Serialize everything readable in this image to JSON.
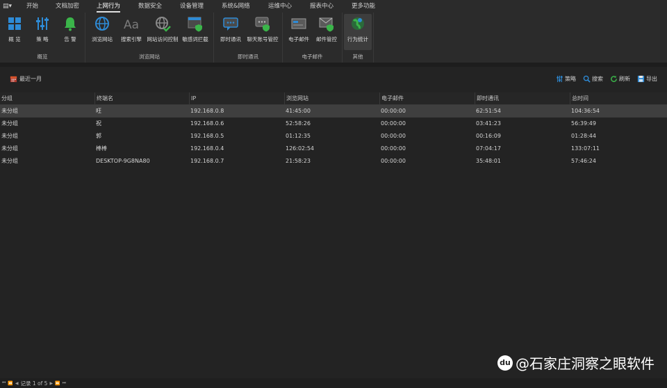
{
  "menu": {
    "app_icon": "▤▾",
    "items": [
      "开始",
      "文档加密",
      "上网行为",
      "数据安全",
      "设备管理",
      "系统&网络",
      "运维中心",
      "报表中心",
      "更多功能"
    ],
    "active": "上网行为"
  },
  "ribbon": {
    "groups": [
      {
        "label": "概览",
        "buttons": [
          {
            "label": "概 览",
            "icon": "dashboard-icon"
          },
          {
            "label": "策 略",
            "icon": "policy-sliders-icon"
          },
          {
            "label": "告 警",
            "icon": "bell-icon"
          }
        ]
      },
      {
        "label": "浏览网站",
        "buttons": [
          {
            "label": "浏览网站",
            "icon": "globe-icon"
          },
          {
            "label": "搜索引擎",
            "icon": "font-aa-icon"
          },
          {
            "label": "网站访问控制",
            "icon": "globe-check-icon"
          },
          {
            "label": "敏感词拦截",
            "icon": "window-shield-icon"
          }
        ]
      },
      {
        "label": "即时通讯",
        "buttons": [
          {
            "label": "即时通讯",
            "icon": "chat-icon"
          },
          {
            "label": "聊天账号管控",
            "icon": "chat-shield-icon"
          }
        ]
      },
      {
        "label": "电子邮件",
        "buttons": [
          {
            "label": "电子邮件",
            "icon": "mail-card-icon"
          },
          {
            "label": "邮件管控",
            "icon": "mail-shield-icon"
          }
        ]
      },
      {
        "label": "其他",
        "buttons": [
          {
            "label": "行为统计",
            "icon": "globe-chart-icon"
          }
        ]
      }
    ]
  },
  "toolbar": {
    "date_range": "最近一月",
    "policy": "策略",
    "search": "搜索",
    "refresh": "刷新",
    "export": "导出"
  },
  "table": {
    "columns": [
      "分组",
      "终端名",
      "IP",
      "浏览网站",
      "电子邮件",
      "即时通讯",
      "总时间"
    ],
    "rows": [
      [
        "未分组",
        "旺",
        "192.168.0.8",
        "41:45:00",
        "00:00:00",
        "62:51:54",
        "104:36:54"
      ],
      [
        "未分组",
        "祝",
        "192.168.0.6",
        "52:58:26",
        "00:00:00",
        "03:41:23",
        "56:39:49"
      ],
      [
        "未分组",
        "郭",
        "192.168.0.5",
        "01:12:35",
        "00:00:00",
        "00:16:09",
        "01:28:44"
      ],
      [
        "未分组",
        "棒棒",
        "192.168.0.4",
        "126:02:54",
        "00:00:00",
        "07:04:17",
        "133:07:11"
      ],
      [
        "未分组",
        "DESKTOP-9G8NA80",
        "192.168.0.7",
        "21:58:23",
        "00:00:00",
        "35:48:01",
        "57:46:24"
      ]
    ]
  },
  "status": {
    "record": "记录 1 of 5"
  },
  "watermark": {
    "text": "@石家庄洞察之眼软件",
    "logo": "du"
  },
  "colors": {
    "background": "#232323",
    "ribbon": "#2b2b2b",
    "selected_row": "#3f3f3f",
    "accent_blue": "#2e8bd6",
    "accent_green": "#3bb54a"
  }
}
